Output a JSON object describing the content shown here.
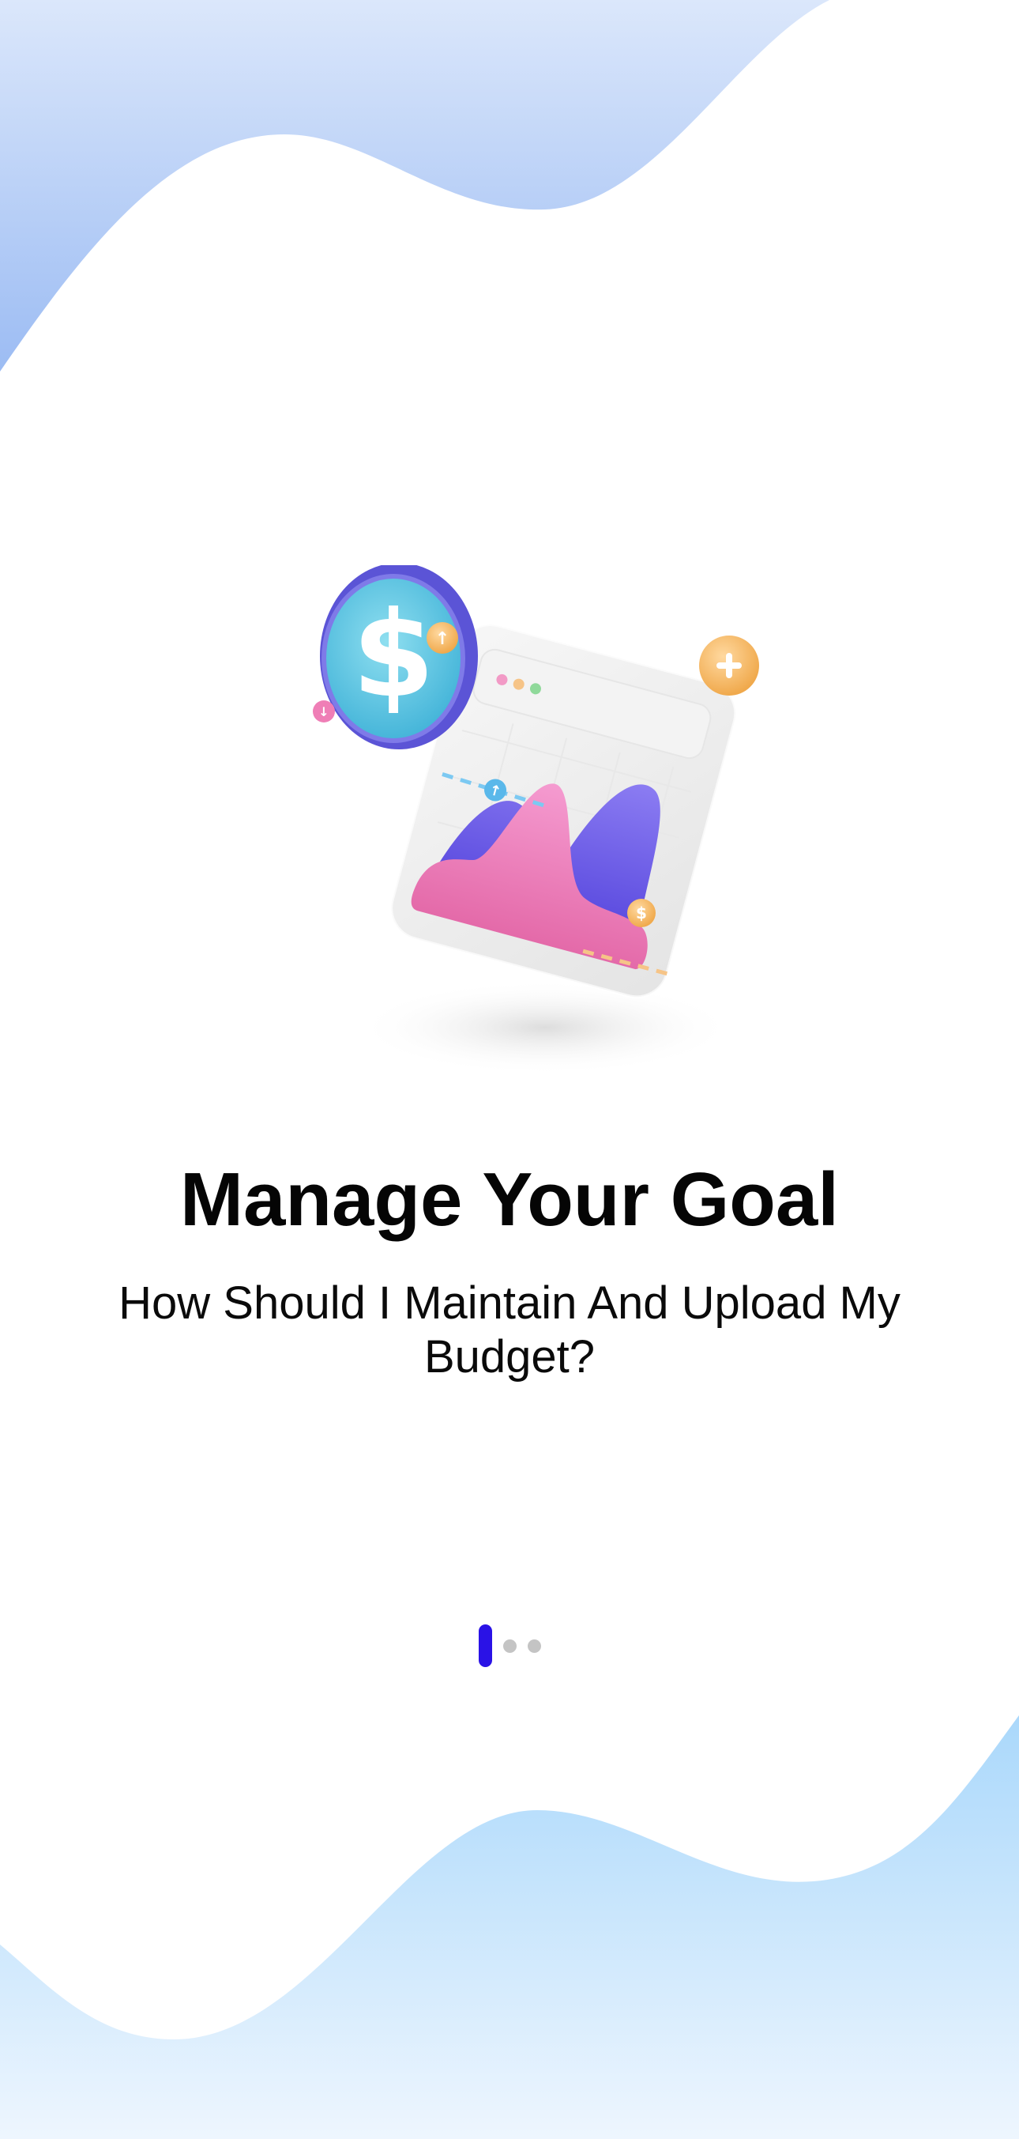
{
  "onboarding": {
    "title": "Manage Your Goal",
    "subtitle": "How Should I Maintain And Upload My Budget?",
    "illustration_icon": "budget-chart-dollar-illustration",
    "pager": {
      "total_pages": 3,
      "current_page": 1
    }
  },
  "colors": {
    "accent": "#2a12e6",
    "inactive_dot": "#c4c4c4",
    "wave_top": "#a8c6f5",
    "wave_bottom": "#b3dcfb"
  }
}
